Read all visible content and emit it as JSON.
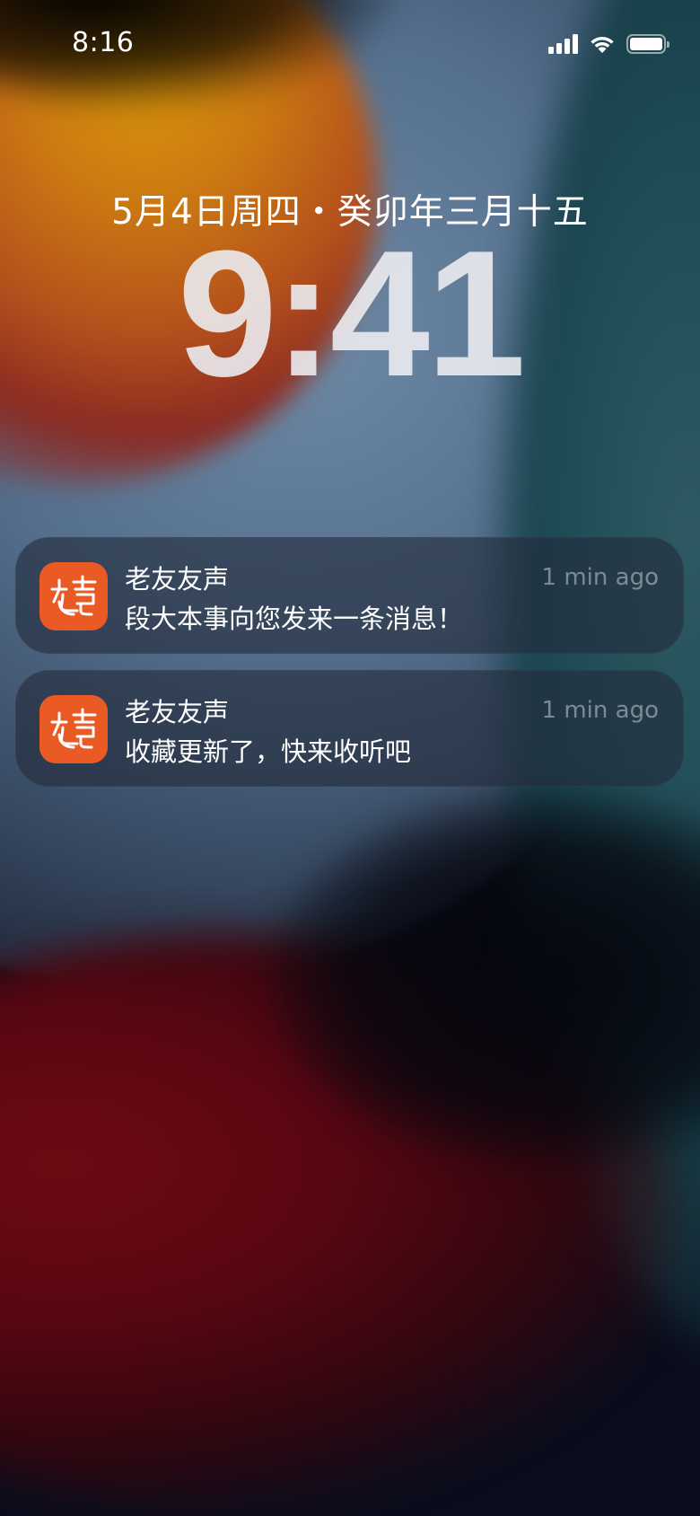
{
  "status_bar": {
    "time": "8:16",
    "icons": [
      "cellular-signal-icon",
      "wifi-icon",
      "battery-icon"
    ],
    "battery_level": 1.0
  },
  "lock_screen": {
    "date": "5月4日周四・癸卯年三月十五",
    "clock": "9:41"
  },
  "notifications": [
    {
      "app_name": "老友友声",
      "message": "段大本事向您发来一条消息！",
      "time": "1 min ago",
      "icon": "app-logo-icon",
      "icon_color": "#ea5a24"
    },
    {
      "app_name": "老友友声",
      "message": "收藏更新了，快来收听吧",
      "time": "1 min ago",
      "icon": "app-logo-icon",
      "icon_color": "#ea5a24"
    }
  ]
}
